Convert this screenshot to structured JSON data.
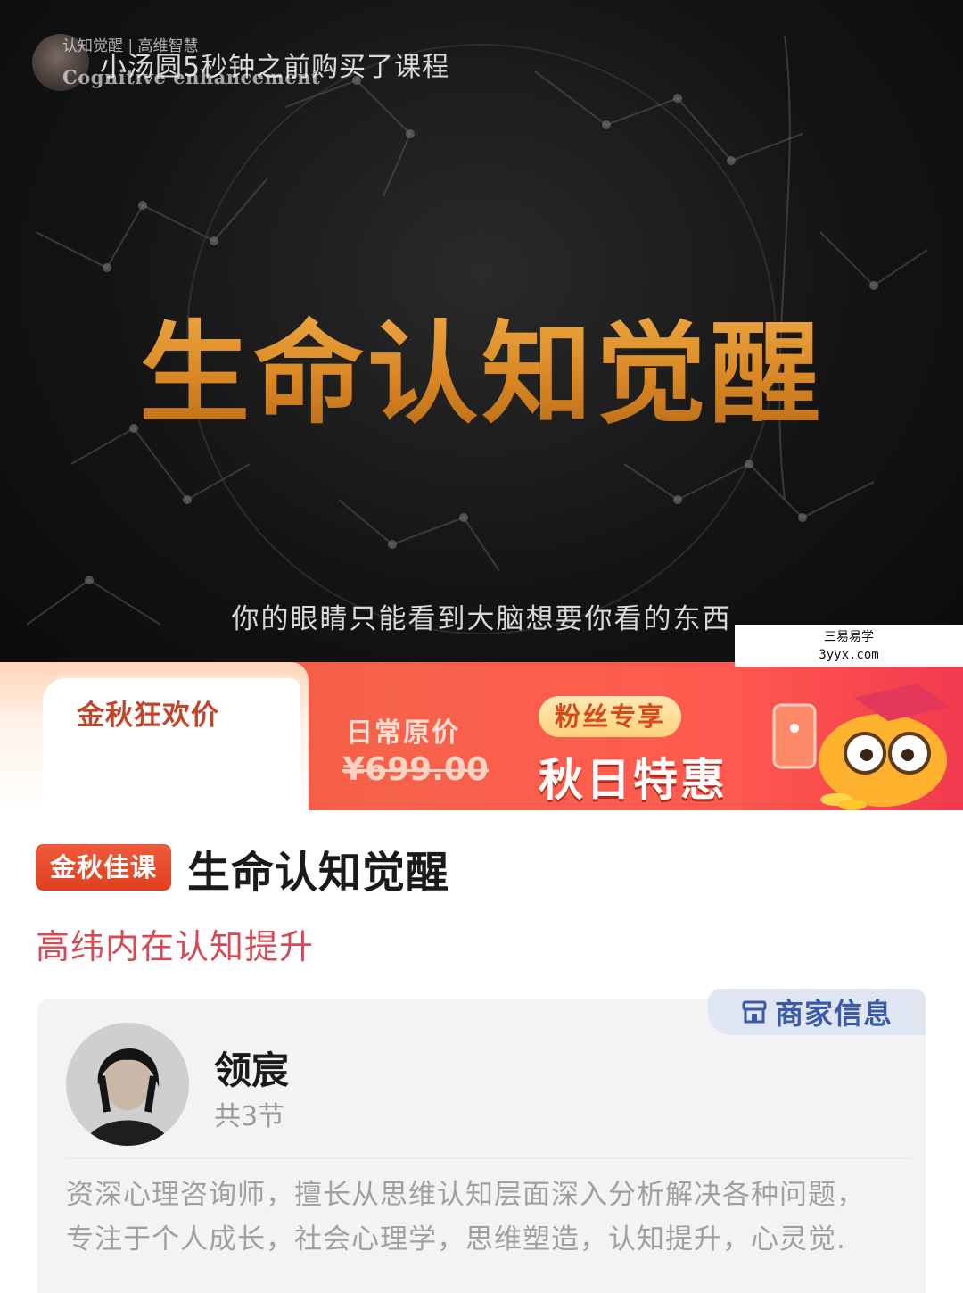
{
  "hero": {
    "brand_cn": "认知觉醒 | 高维智慧",
    "brand_en": "Cognitive enhancement",
    "purchase_notice": "小汤圆5秒钟之前购买了课程",
    "title": "生命认知觉醒",
    "subtitle": "你的眼睛只能看到大脑想要你看的东西"
  },
  "watermark": {
    "line1": "三易易学",
    "line2": "3yyx.com"
  },
  "promo": {
    "left_label": "金秋狂欢价",
    "original_label": "日常原价",
    "original_price": "¥699.00",
    "fans_badge": "粉丝专享",
    "headline": "秋日特惠"
  },
  "course": {
    "tag": "金秋佳课",
    "title": "生命认知觉醒",
    "subtitle": "高纬内在认知提升"
  },
  "merchant": {
    "tab_label": "商家信息",
    "teacher_name": "领宸",
    "lessons": "共3节",
    "bio_lines": [
      "资深心理咨询师，擅长从思维认知层面深入分析解决各种问题，",
      "专注于个人成长，社会心理学，思维塑造，认知提升，心灵觉."
    ]
  },
  "colors": {
    "title_gold": "#e2972f",
    "promo_red": "#f14b35",
    "tag_red": "#e0401f",
    "subtitle_red": "#d44a55",
    "merchant_blue": "#3b5aa8"
  }
}
